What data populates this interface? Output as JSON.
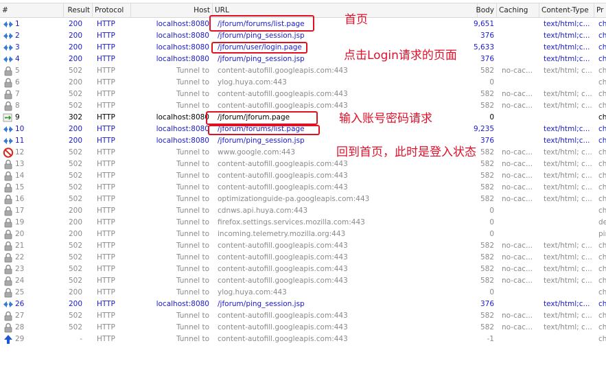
{
  "columns": {
    "num": "#",
    "result": "Result",
    "protocol": "Protocol",
    "host": "Host",
    "url": "URL",
    "body": "Body",
    "caching": "Caching",
    "content_type": "Content-Type",
    "process": "Pr"
  },
  "rows": [
    {
      "id": "1",
      "result": "200",
      "protocol": "HTTP",
      "host": "localhost:8080",
      "url": "/jforum/forums/list.page",
      "body": "9,651",
      "caching": "",
      "ctype": "text/html;c...",
      "proc": "ch",
      "style": "blue",
      "icon": "arrows-icon"
    },
    {
      "id": "2",
      "result": "200",
      "protocol": "HTTP",
      "host": "localhost:8080",
      "url": "/jforum/ping_session.jsp",
      "body": "376",
      "caching": "",
      "ctype": "text/html;c...",
      "proc": "ch",
      "style": "blue",
      "icon": "arrows-icon"
    },
    {
      "id": "3",
      "result": "200",
      "protocol": "HTTP",
      "host": "localhost:8080",
      "url": "/jforum/user/login.page",
      "body": "5,633",
      "caching": "",
      "ctype": "text/html;c...",
      "proc": "ch",
      "style": "blue",
      "icon": "arrows-icon"
    },
    {
      "id": "4",
      "result": "200",
      "protocol": "HTTP",
      "host": "localhost:8080",
      "url": "/jforum/ping_session.jsp",
      "body": "376",
      "caching": "",
      "ctype": "text/html;c...",
      "proc": "ch",
      "style": "blue",
      "icon": "arrows-icon"
    },
    {
      "id": "5",
      "result": "502",
      "protocol": "HTTP",
      "host": "Tunnel to",
      "url": "content-autofill.googleapis.com:443",
      "body": "582",
      "caching": "no-cac...",
      "ctype": "text/html; c...",
      "proc": "ch",
      "style": "gray",
      "icon": "lock-icon"
    },
    {
      "id": "6",
      "result": "200",
      "protocol": "HTTP",
      "host": "Tunnel to",
      "url": "ylog.huya.com:443",
      "body": "0",
      "caching": "",
      "ctype": "",
      "proc": "ch",
      "style": "gray",
      "icon": "lock-icon"
    },
    {
      "id": "7",
      "result": "502",
      "protocol": "HTTP",
      "host": "Tunnel to",
      "url": "content-autofill.googleapis.com:443",
      "body": "582",
      "caching": "no-cac...",
      "ctype": "text/html; c...",
      "proc": "ch",
      "style": "gray",
      "icon": "lock-icon"
    },
    {
      "id": "8",
      "result": "502",
      "protocol": "HTTP",
      "host": "Tunnel to",
      "url": "content-autofill.googleapis.com:443",
      "body": "582",
      "caching": "no-cac...",
      "ctype": "text/html; c...",
      "proc": "ch",
      "style": "gray",
      "icon": "lock-icon"
    },
    {
      "id": "9",
      "result": "302",
      "protocol": "HTTP",
      "host": "localhost:8080",
      "url": "/jforum/jforum.page",
      "body": "0",
      "caching": "",
      "ctype": "",
      "proc": "ch",
      "style": "black",
      "icon": "redirect-icon"
    },
    {
      "id": "10",
      "result": "200",
      "protocol": "HTTP",
      "host": "localhost:8080",
      "url": "/jforum/forums/list.page",
      "body": "9,235",
      "caching": "",
      "ctype": "text/html;c...",
      "proc": "ch",
      "style": "blue",
      "icon": "arrows-icon"
    },
    {
      "id": "11",
      "result": "200",
      "protocol": "HTTP",
      "host": "localhost:8080",
      "url": "/jforum/ping_session.jsp",
      "body": "376",
      "caching": "",
      "ctype": "text/html;c...",
      "proc": "ch",
      "style": "blue",
      "icon": "arrows-icon"
    },
    {
      "id": "12",
      "result": "502",
      "protocol": "HTTP",
      "host": "Tunnel to",
      "url": "www.google.com:443",
      "body": "582",
      "caching": "no-cac...",
      "ctype": "text/html; c...",
      "proc": "ch",
      "style": "gray",
      "icon": "blocked-icon"
    },
    {
      "id": "13",
      "result": "502",
      "protocol": "HTTP",
      "host": "Tunnel to",
      "url": "content-autofill.googleapis.com:443",
      "body": "582",
      "caching": "no-cac...",
      "ctype": "text/html; c...",
      "proc": "ch",
      "style": "gray",
      "icon": "lock-icon"
    },
    {
      "id": "14",
      "result": "502",
      "protocol": "HTTP",
      "host": "Tunnel to",
      "url": "content-autofill.googleapis.com:443",
      "body": "582",
      "caching": "no-cac...",
      "ctype": "text/html; c...",
      "proc": "ch",
      "style": "gray",
      "icon": "lock-icon"
    },
    {
      "id": "15",
      "result": "502",
      "protocol": "HTTP",
      "host": "Tunnel to",
      "url": "content-autofill.googleapis.com:443",
      "body": "582",
      "caching": "no-cac...",
      "ctype": "text/html; c...",
      "proc": "ch",
      "style": "gray",
      "icon": "lock-icon"
    },
    {
      "id": "16",
      "result": "502",
      "protocol": "HTTP",
      "host": "Tunnel to",
      "url": "optimizationguide-pa.googleapis.com:443",
      "body": "582",
      "caching": "no-cac...",
      "ctype": "text/html; c...",
      "proc": "ch",
      "style": "gray",
      "icon": "lock-icon"
    },
    {
      "id": "17",
      "result": "200",
      "protocol": "HTTP",
      "host": "Tunnel to",
      "url": "cdnws.api.huya.com:443",
      "body": "0",
      "caching": "",
      "ctype": "",
      "proc": "ch",
      "style": "gray",
      "icon": "lock-icon"
    },
    {
      "id": "19",
      "result": "200",
      "protocol": "HTTP",
      "host": "Tunnel to",
      "url": "firefox.settings.services.mozilla.com:443",
      "body": "0",
      "caching": "",
      "ctype": "",
      "proc": "de",
      "style": "gray",
      "icon": "lock-icon"
    },
    {
      "id": "20",
      "result": "200",
      "protocol": "HTTP",
      "host": "Tunnel to",
      "url": "incoming.telemetry.mozilla.org:443",
      "body": "0",
      "caching": "",
      "ctype": "",
      "proc": "pir",
      "style": "gray",
      "icon": "lock-icon"
    },
    {
      "id": "21",
      "result": "502",
      "protocol": "HTTP",
      "host": "Tunnel to",
      "url": "content-autofill.googleapis.com:443",
      "body": "582",
      "caching": "no-cac...",
      "ctype": "text/html; c...",
      "proc": "ch",
      "style": "gray",
      "icon": "lock-icon"
    },
    {
      "id": "22",
      "result": "502",
      "protocol": "HTTP",
      "host": "Tunnel to",
      "url": "content-autofill.googleapis.com:443",
      "body": "582",
      "caching": "no-cac...",
      "ctype": "text/html; c...",
      "proc": "ch",
      "style": "gray",
      "icon": "lock-icon"
    },
    {
      "id": "23",
      "result": "502",
      "protocol": "HTTP",
      "host": "Tunnel to",
      "url": "content-autofill.googleapis.com:443",
      "body": "582",
      "caching": "no-cac...",
      "ctype": "text/html; c...",
      "proc": "ch",
      "style": "gray",
      "icon": "lock-icon"
    },
    {
      "id": "24",
      "result": "502",
      "protocol": "HTTP",
      "host": "Tunnel to",
      "url": "content-autofill.googleapis.com:443",
      "body": "582",
      "caching": "no-cac...",
      "ctype": "text/html; c...",
      "proc": "ch",
      "style": "gray",
      "icon": "lock-icon"
    },
    {
      "id": "25",
      "result": "200",
      "protocol": "HTTP",
      "host": "Tunnel to",
      "url": "ylog.huya.com:443",
      "body": "0",
      "caching": "",
      "ctype": "",
      "proc": "ch",
      "style": "gray",
      "icon": "lock-icon"
    },
    {
      "id": "26",
      "result": "200",
      "protocol": "HTTP",
      "host": "localhost:8080",
      "url": "/jforum/ping_session.jsp",
      "body": "376",
      "caching": "",
      "ctype": "text/html;c...",
      "proc": "ch",
      "style": "blue",
      "icon": "arrows-icon"
    },
    {
      "id": "27",
      "result": "502",
      "protocol": "HTTP",
      "host": "Tunnel to",
      "url": "content-autofill.googleapis.com:443",
      "body": "582",
      "caching": "no-cac...",
      "ctype": "text/html; c...",
      "proc": "ch",
      "style": "gray",
      "icon": "lock-icon"
    },
    {
      "id": "28",
      "result": "502",
      "protocol": "HTTP",
      "host": "Tunnel to",
      "url": "content-autofill.googleapis.com:443",
      "body": "582",
      "caching": "no-cac...",
      "ctype": "text/html; c...",
      "proc": "ch",
      "style": "gray",
      "icon": "lock-icon"
    },
    {
      "id": "29",
      "result": "-",
      "protocol": "HTTP",
      "host": "Tunnel to",
      "url": "content-autofill.googleapis.com:443",
      "body": "-1",
      "caching": "",
      "ctype": "",
      "proc": "ch",
      "style": "gray",
      "icon": "upload-arrow-icon"
    }
  ],
  "annotations": {
    "homepage": "首页",
    "login_page": "点击Login请求的页面",
    "login_request": "输入账号密码请求",
    "back_home": "回到首页，此时是登入状态"
  },
  "colors": {
    "annotation_red": "#e0102a",
    "link_blue": "#1a1acc",
    "muted_gray": "#8a8a8a"
  }
}
